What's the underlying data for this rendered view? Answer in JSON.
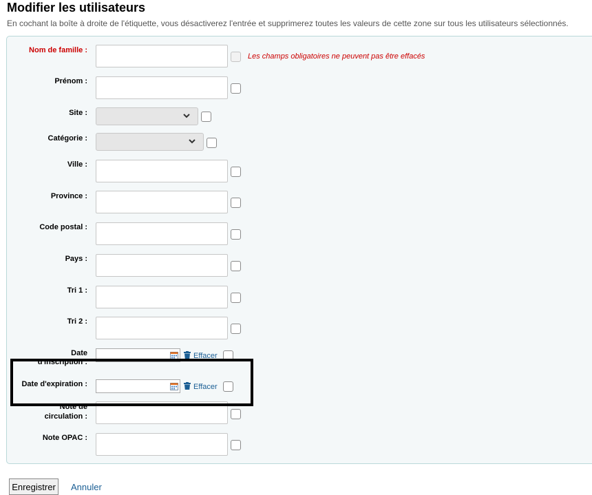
{
  "page": {
    "title": "Modifier les utilisateurs",
    "intro": "En cochant la boîte à droite de l'étiquette, vous désactiverez l'entrée et supprimerez toutes les valeurs de cette zone sur tous les utilisateurs sélectionnés."
  },
  "fields": {
    "surname": {
      "label": "Nom de famille :",
      "note": "Les champs obligatoires ne peuvent pas être effacés"
    },
    "firstname": {
      "label": "Prénom :"
    },
    "site": {
      "label": "Site :"
    },
    "category": {
      "label": "Catégorie :"
    },
    "city": {
      "label": "Ville :"
    },
    "province": {
      "label": "Province :"
    },
    "zipcode": {
      "label": "Code postal :"
    },
    "country": {
      "label": "Pays :"
    },
    "sort1": {
      "label": "Tri 1 :"
    },
    "sort2": {
      "label": "Tri 2 :"
    },
    "dateenrolled": {
      "label_line1": "Date",
      "label_line2": "d'inscription :",
      "clear_label": "Effacer"
    },
    "dateexpiry": {
      "label": "Date d'expiration :",
      "clear_label": "Effacer"
    },
    "circnote": {
      "label_line1": "Note de",
      "label_line2": "circulation :"
    },
    "opacnote": {
      "label": "Note OPAC :"
    }
  },
  "actions": {
    "save_label": "Enregistrer",
    "cancel_label": "Annuler"
  },
  "icons": {
    "calendar": "calendar-icon",
    "trash": "trash-icon",
    "chevron": "chevron-down-icon"
  },
  "colors": {
    "required": "#cc0000",
    "link": "#1a5e94",
    "panel_bg": "#f4f8f9",
    "panel_border": "#b9d8d9"
  }
}
